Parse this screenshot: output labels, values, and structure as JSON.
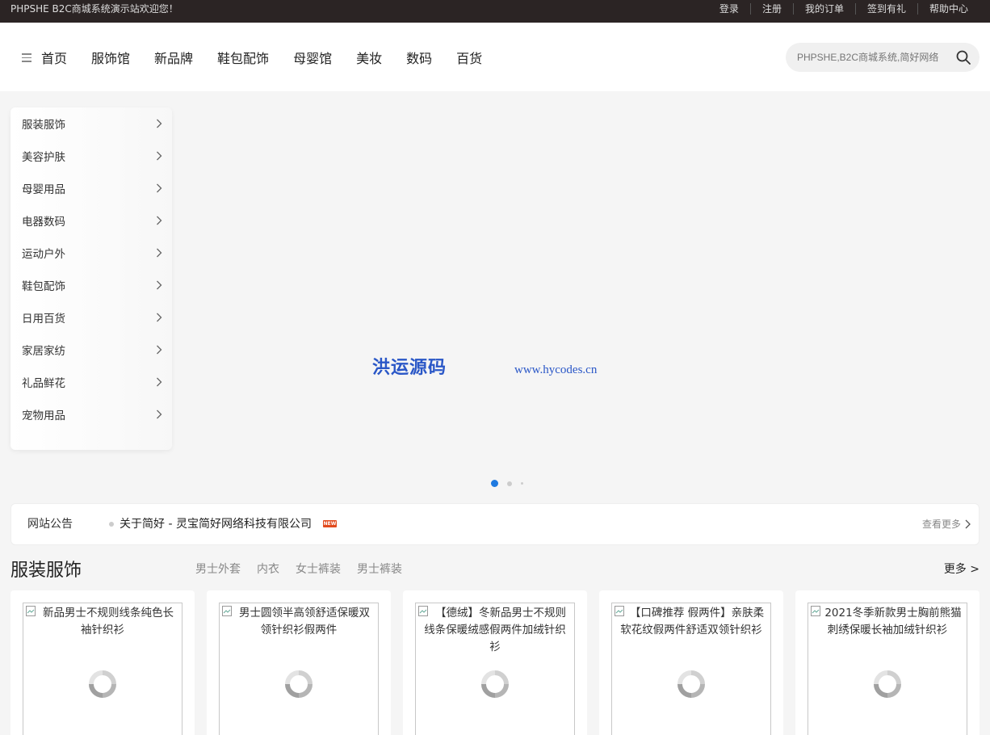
{
  "topbar": {
    "welcome": "PHPSHE B2C商城系统演示站欢迎您！",
    "links": [
      "登录",
      "注册",
      "我的订单",
      "签到有礼",
      "帮助中心"
    ]
  },
  "nav": {
    "items": [
      "首页",
      "服饰馆",
      "新品牌",
      "鞋包配饰",
      "母婴馆",
      "美妆",
      "数码",
      "百货"
    ]
  },
  "search": {
    "placeholder": "PHPSHE,B2C商城系统,简好网络"
  },
  "sidebar": {
    "items": [
      "服装服饰",
      "美容护肤",
      "母婴用品",
      "电器数码",
      "运动户外",
      "鞋包配饰",
      "日用百货",
      "家居家纺",
      "礼品鲜花",
      "宠物用品"
    ]
  },
  "banner": {
    "brand": "洪运源码",
    "url": "www.hycodes.cn"
  },
  "notice": {
    "label": "网站公告",
    "text": "关于简好 - 灵宝简好网络科技有限公司",
    "badge": "NEW",
    "more": "查看更多"
  },
  "section": {
    "title": "服装服饰",
    "tabs": [
      "男士外套",
      "内衣",
      "女士裤装",
      "男士裤装"
    ],
    "more": "更多 >"
  },
  "products": [
    {
      "title": "新品男士不规则线条纯色长袖针织衫"
    },
    {
      "title": "男士圆领半高领舒适保暖双领针织衫假两件"
    },
    {
      "title": "【德绒】冬新品男士不规则线条保暖绒感假两件加绒针织衫"
    },
    {
      "title": "【口碑推荐 假两件】亲肤柔软花纹假两件舒适双领针织衫"
    },
    {
      "title": "2021冬季新款男士胸前熊猫刺绣保暖长袖加绒针织衫"
    }
  ],
  "colors": {
    "topbar_bg": "#2b2424",
    "accent_blue": "#1f7ae0",
    "banner_text": "#2a57c7",
    "new_badge": "#e24a1d"
  }
}
